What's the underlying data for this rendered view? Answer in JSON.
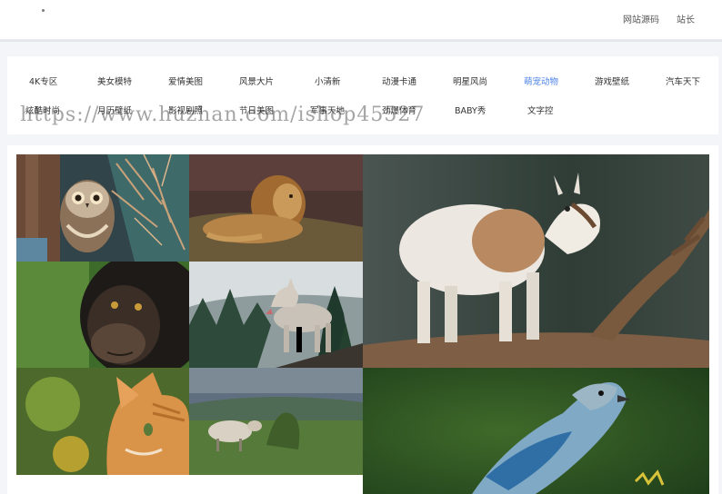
{
  "header": {
    "source_link": "网站源码",
    "admin_link": "站长"
  },
  "categories": [
    {
      "label": "4K专区"
    },
    {
      "label": "美女模特"
    },
    {
      "label": "爱情美图"
    },
    {
      "label": "风景大片"
    },
    {
      "label": "小清新"
    },
    {
      "label": "动漫卡通"
    },
    {
      "label": "明星风尚"
    },
    {
      "label": "萌宠动物",
      "active": true
    },
    {
      "label": "游戏壁纸"
    },
    {
      "label": "汽车天下"
    },
    {
      "label": "炫酷时尚"
    },
    {
      "label": "月历壁纸"
    },
    {
      "label": "影视剧照"
    },
    {
      "label": "节日美图"
    },
    {
      "label": "军事天地"
    },
    {
      "label": "劲爆体育"
    },
    {
      "label": "BABY秀"
    },
    {
      "label": "文字控"
    }
  ],
  "watermark": "https://www.huzhan.com/ishop45527",
  "gallery": [
    {
      "subject": "owl"
    },
    {
      "subject": "lion"
    },
    {
      "subject": "goat"
    },
    {
      "subject": "chimpanzee"
    },
    {
      "subject": "wolf"
    },
    {
      "subject": "cat"
    },
    {
      "subject": "sheep"
    },
    {
      "subject": "bird"
    }
  ],
  "colors": {
    "accent": "#4b82e6",
    "background": "#f4f5f8"
  }
}
